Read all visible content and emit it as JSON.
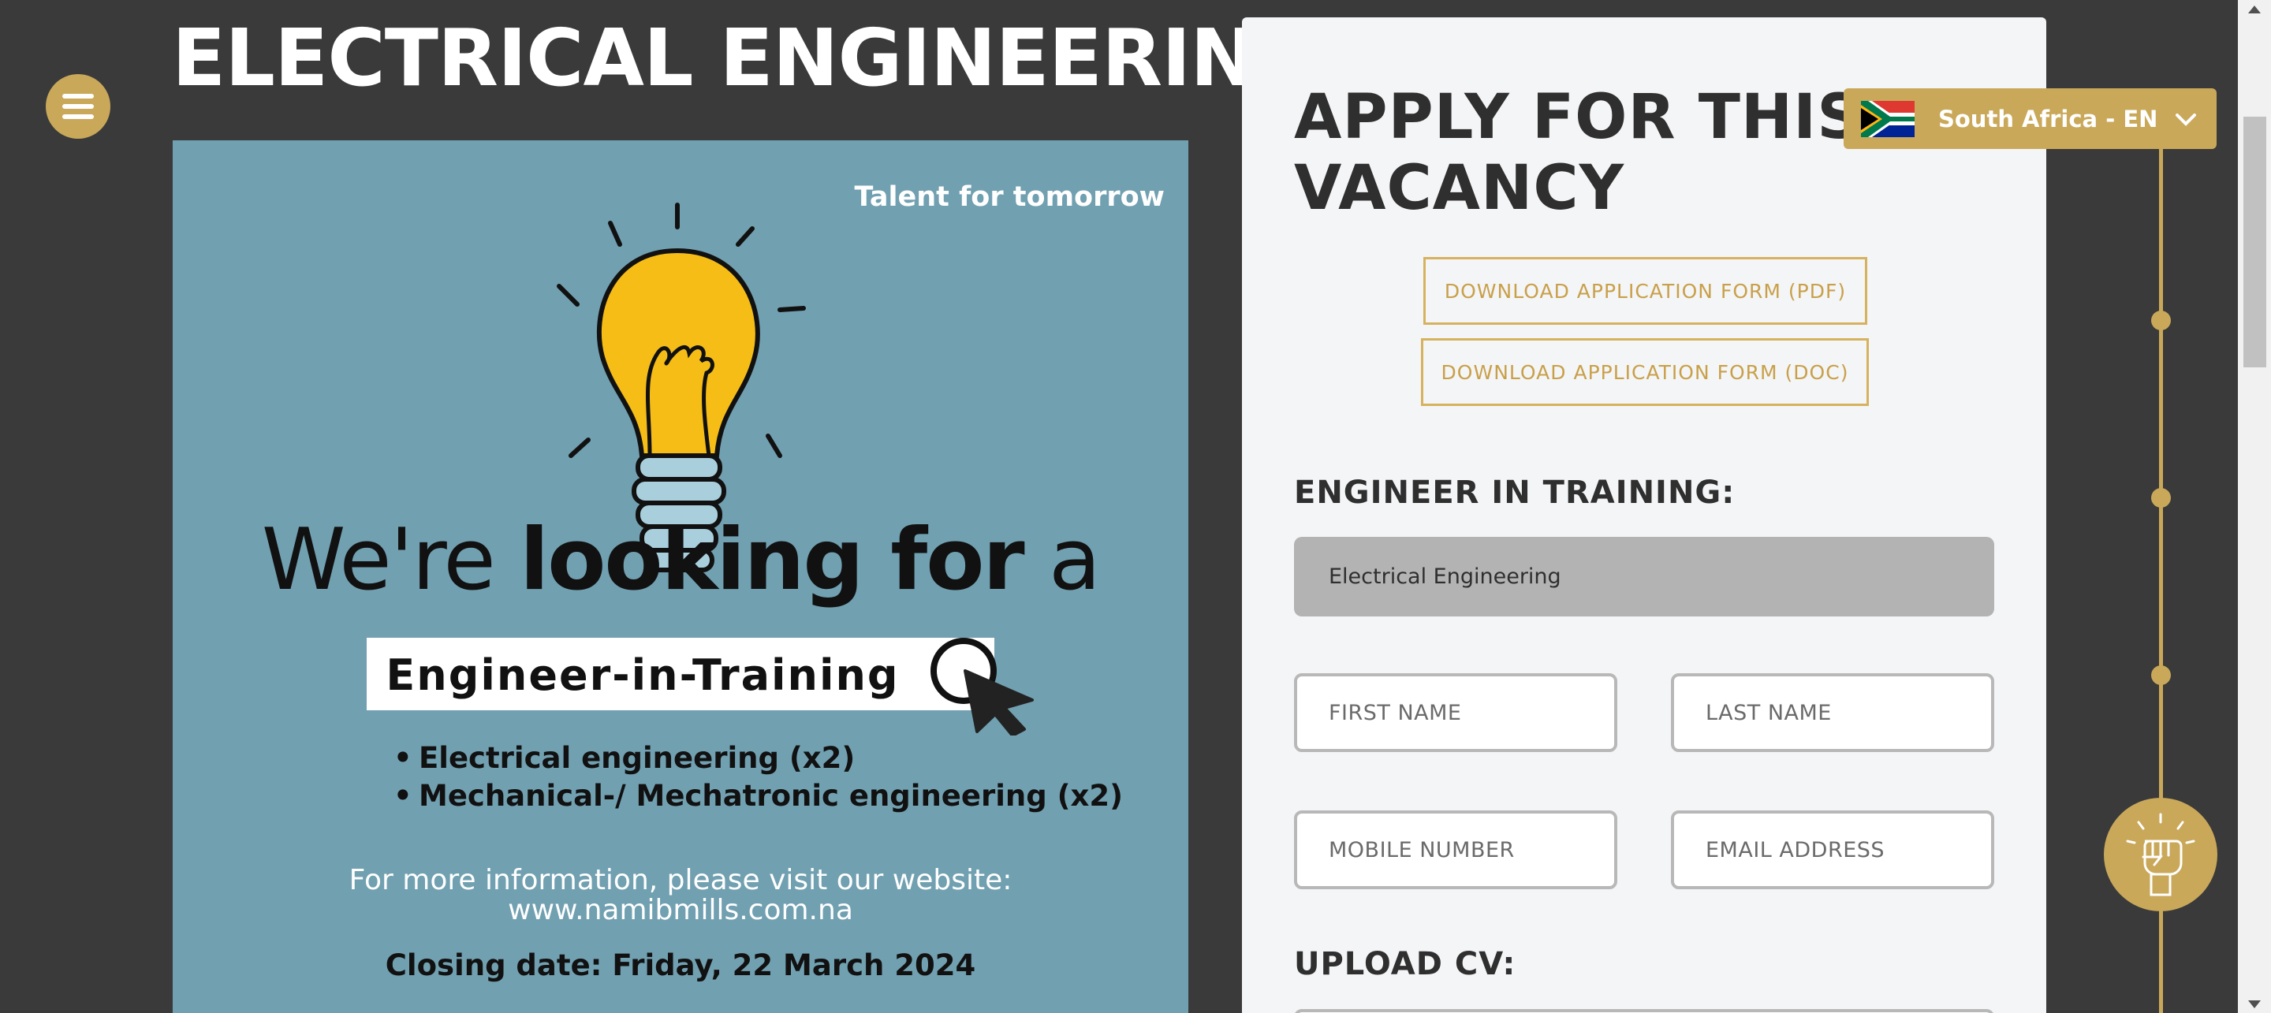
{
  "page": {
    "title": "ELECTRICAL ENGINEERING"
  },
  "poster": {
    "tagline": "Talent for tomorrow",
    "headline_light": "We're",
    "headline_bold": "looking for",
    "headline_end": "a",
    "role": "Engineer-in-Training",
    "positions": [
      "Electrical engineering (x2)",
      "Mechanical-/ Mechatronic engineering (x2)"
    ],
    "info_line1": "For more information, please visit our website:",
    "info_line2": "www.namibmills.com.na",
    "closing": "Closing date: Friday, 22 March 2024"
  },
  "form": {
    "title_line1": "APPLY FOR THIS",
    "title_line2": "VACANCY",
    "download_pdf": "DOWNLOAD APPLICATION FORM (PDF)",
    "download_doc": "DOWNLOAD APPLICATION FORM (DOC)",
    "eit_label": "ENGINEER IN TRAINING:",
    "eit_selected": "Electrical Engineering",
    "first_name": "FIRST NAME",
    "last_name": "LAST NAME",
    "mobile": "MOBILE NUMBER",
    "email": "EMAIL ADDRESS",
    "upload_cv": "UPLOAD CV:"
  },
  "country_selector": {
    "label": "South Africa - EN"
  },
  "colors": {
    "accent": "#c9a85a",
    "background": "#3a3a3a",
    "poster": "#71a0b1",
    "panel": "#f4f5f7"
  }
}
